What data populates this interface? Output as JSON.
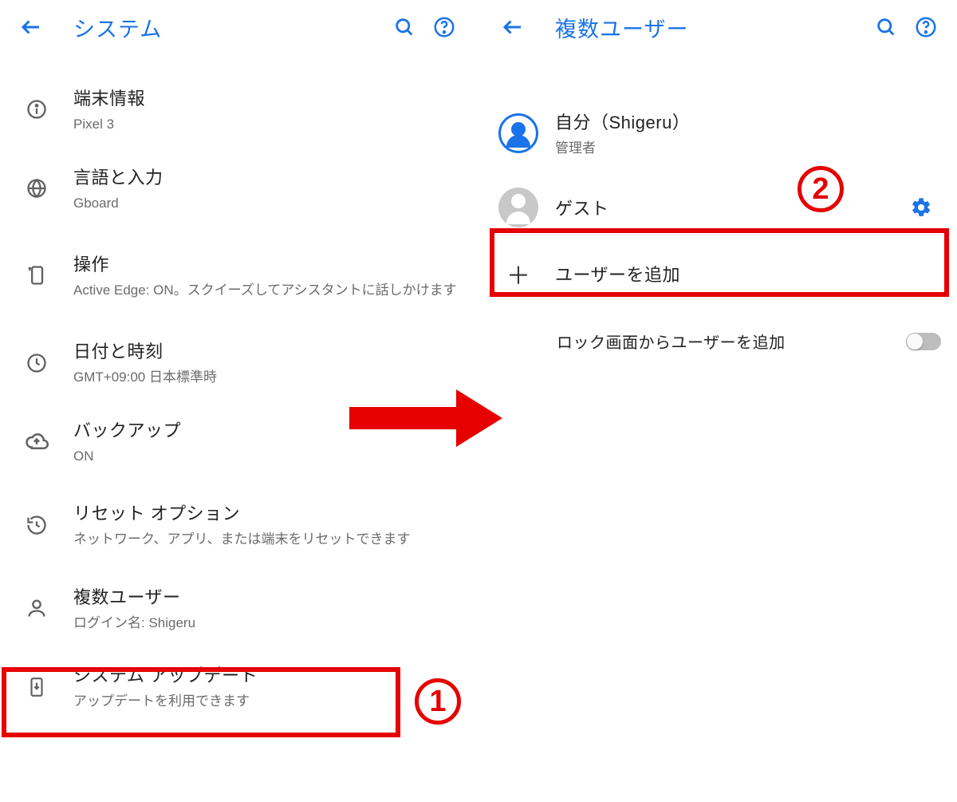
{
  "annotations": {
    "step1": "1",
    "step2": "2"
  },
  "left": {
    "title": "システム",
    "items": [
      {
        "title": "端末情報",
        "sub": "Pixel 3"
      },
      {
        "title": "言語と入力",
        "sub": "Gboard"
      },
      {
        "title": "操作",
        "sub": "Active Edge: ON。スクイーズしてアシスタントに話しかけます"
      },
      {
        "title": "日付と時刻",
        "sub": "GMT+09:00 日本標準時"
      },
      {
        "title": "バックアップ",
        "sub": "ON"
      },
      {
        "title": "リセット オプション",
        "sub": "ネットワーク、アプリ、または端末をリセットできます"
      },
      {
        "title": "複数ユーザー",
        "sub": "ログイン名: Shigeru"
      },
      {
        "title": "システム アップデート",
        "sub": "アップデートを利用できます"
      }
    ]
  },
  "right": {
    "title": "複数ユーザー",
    "self": {
      "title": "自分（Shigeru）",
      "sub": "管理者"
    },
    "guest": {
      "title": "ゲスト"
    },
    "add": {
      "title": "ユーザーを追加"
    },
    "lockadd": {
      "title": "ロック画面からユーザーを追加"
    }
  }
}
